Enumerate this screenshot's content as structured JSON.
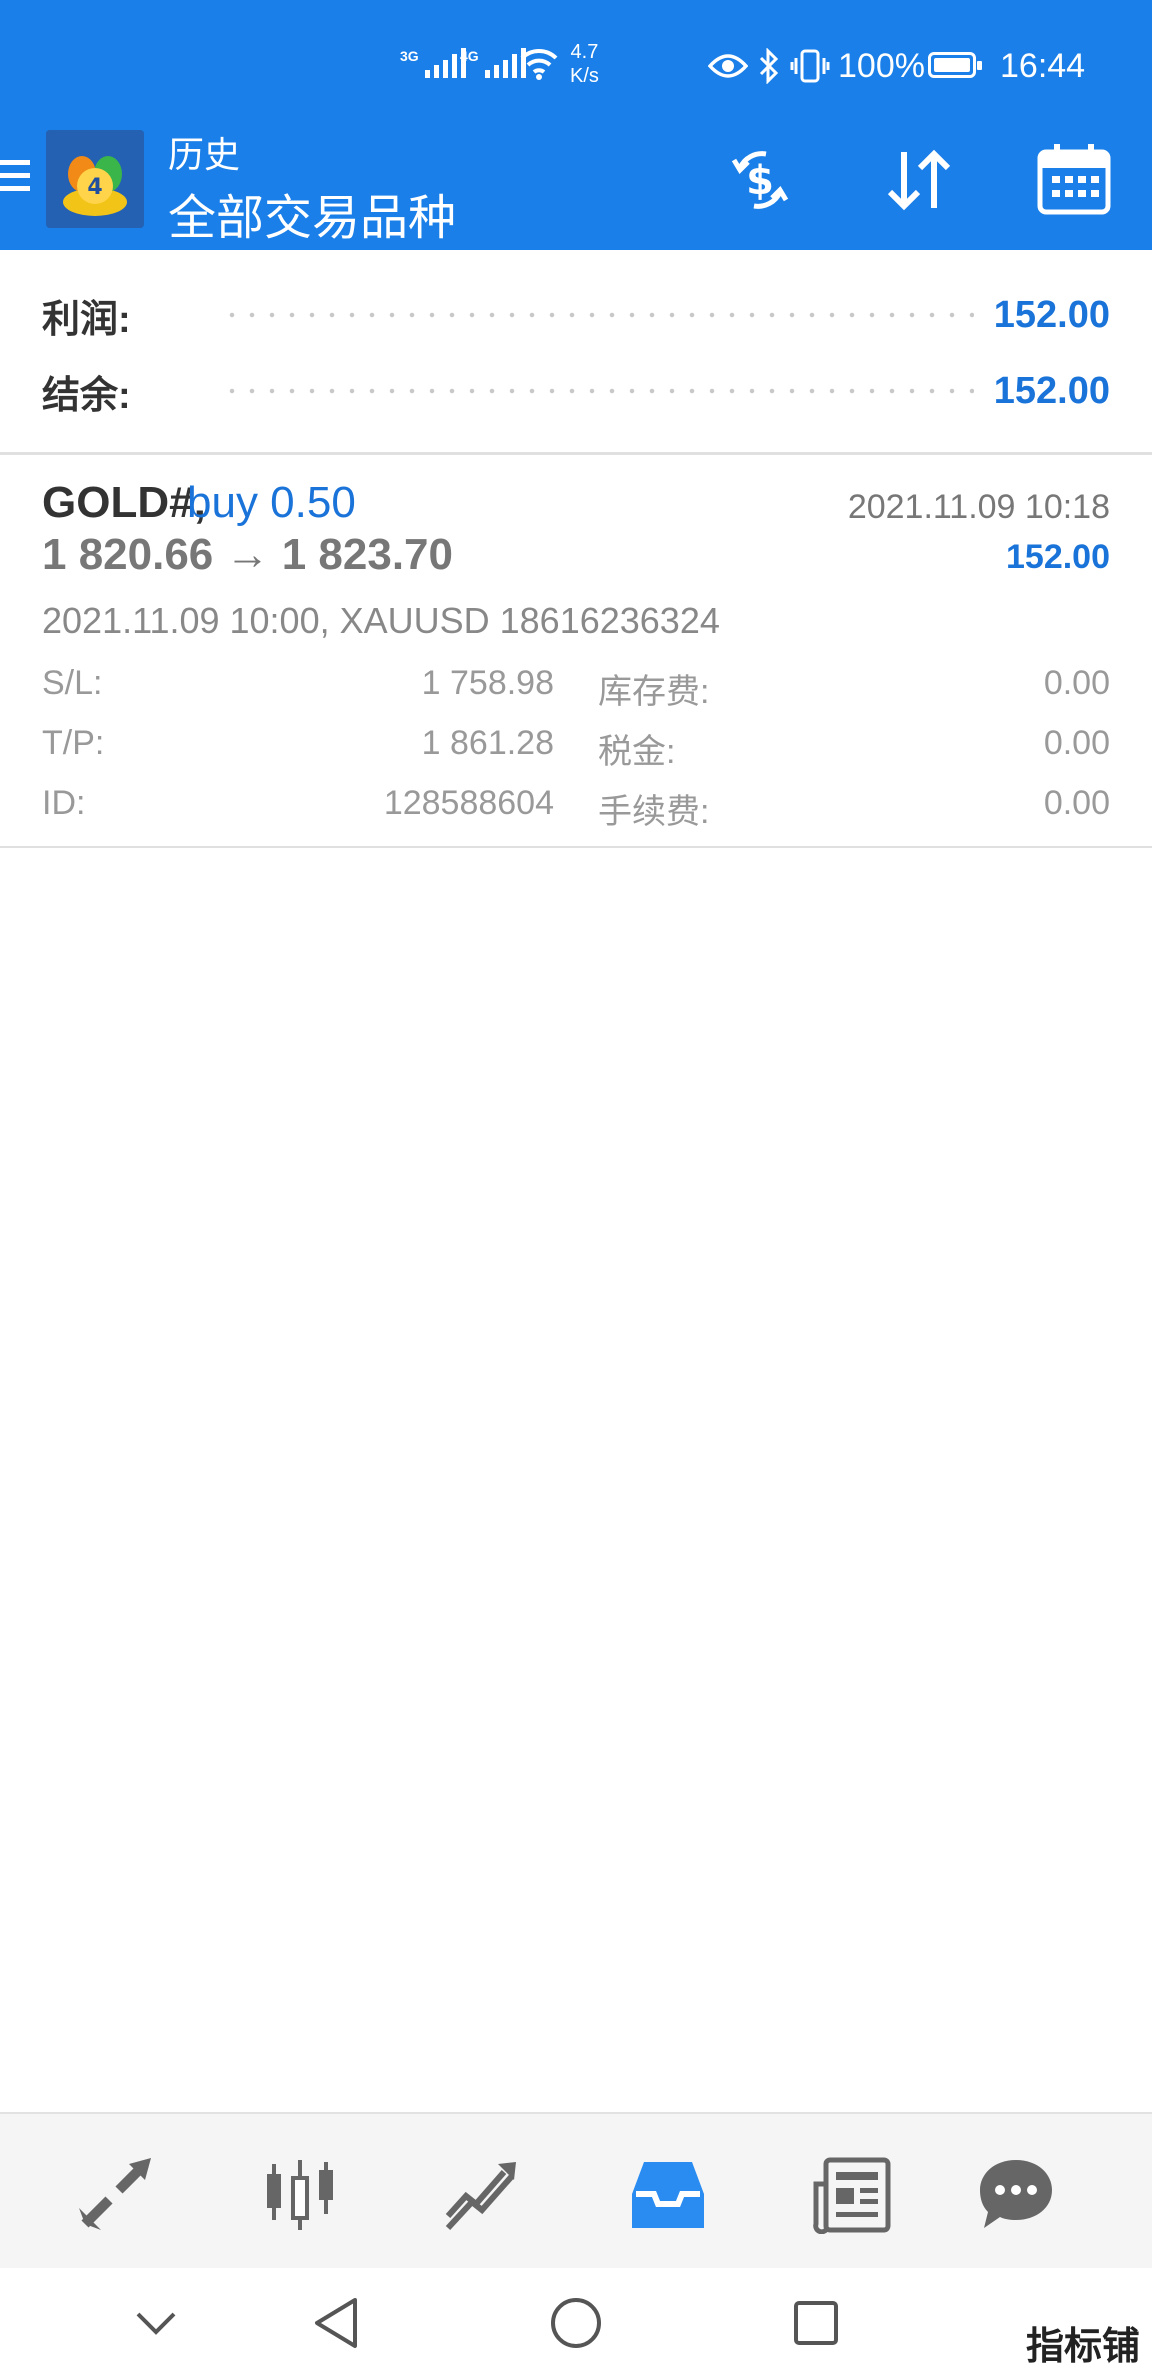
{
  "status_bar": {
    "network_1": "3G",
    "network_2": "4G",
    "speed_value": "4.7",
    "speed_unit": "K/s",
    "battery_percent": "100%",
    "battery_level": 1.0,
    "time": "16:44"
  },
  "header": {
    "subtitle": "历史",
    "title": "全部交易品种",
    "icons": [
      "balance-operations-icon",
      "sort-icon",
      "calendar-icon"
    ]
  },
  "summary": {
    "profit_label": "利润:",
    "profit_value": "152.00",
    "balance_label": "结余:",
    "balance_value": "152.00"
  },
  "deal": {
    "symbol": "GOLD#,",
    "type": "buy 0.50",
    "close_time": "2021.11.09 10:18",
    "prices": "1 820.66 → 1 823.70",
    "profit": "152.00",
    "info": "2021.11.09 10:00, XAUUSD 18616236324",
    "sl_label": "S/L:",
    "sl_value": "1 758.98",
    "tp_label": "T/P:",
    "tp_value": "1 861.28",
    "id_label": "ID:",
    "id_value": "128588604",
    "swap_label": "库存费:",
    "swap_value": "0.00",
    "tax_label": "税金:",
    "tax_value": "0.00",
    "commission_label": "手续费:",
    "commission_value": "0.00"
  },
  "tabbar": {
    "active_tab": "history",
    "tabs": [
      "quotes-icon",
      "chart-icon",
      "trade-icon",
      "history-icon",
      "news-icon",
      "chat-icon"
    ]
  },
  "system_nav": [
    "hide-keyboard-icon",
    "back-icon",
    "home-icon",
    "recents-icon"
  ],
  "watermark": "指标铺",
  "colors": {
    "header": "#1a7fe8",
    "accent": "#1a73d9"
  }
}
